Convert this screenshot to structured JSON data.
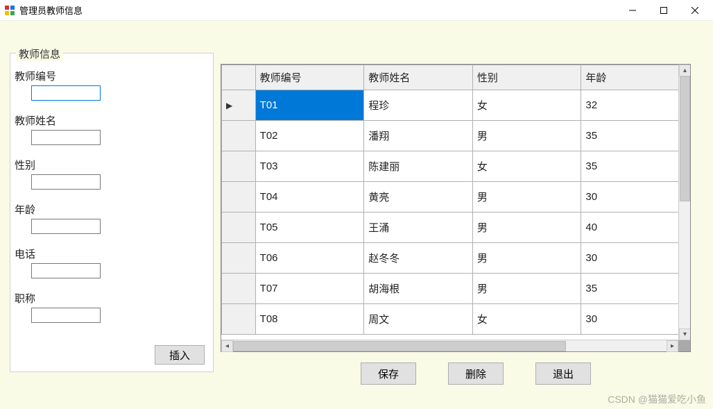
{
  "window": {
    "title": "管理员教师信息"
  },
  "groupbox": {
    "title": "教师信息",
    "fields": {
      "teacher_id": {
        "label": "教师编号",
        "value": ""
      },
      "teacher_name": {
        "label": "教师姓名",
        "value": ""
      },
      "gender": {
        "label": "性别",
        "value": ""
      },
      "age": {
        "label": "年龄",
        "value": ""
      },
      "phone": {
        "label": "电话",
        "value": ""
      },
      "title": {
        "label": "职称",
        "value": ""
      }
    },
    "insert_label": "插入"
  },
  "grid": {
    "columns": [
      "教师编号",
      "教师姓名",
      "性别",
      "年龄"
    ],
    "rows": [
      {
        "id": "T01",
        "name": "程珍",
        "gender": "女",
        "age": "32"
      },
      {
        "id": "T02",
        "name": "潘翔",
        "gender": "男",
        "age": "35"
      },
      {
        "id": "T03",
        "name": "陈建丽",
        "gender": "女",
        "age": "35"
      },
      {
        "id": "T04",
        "name": "黄亮",
        "gender": "男",
        "age": "30"
      },
      {
        "id": "T05",
        "name": "王涌",
        "gender": "男",
        "age": "40"
      },
      {
        "id": "T06",
        "name": "赵冬冬",
        "gender": "男",
        "age": "30"
      },
      {
        "id": "T07",
        "name": "胡海根",
        "gender": "男",
        "age": "35"
      },
      {
        "id": "T08",
        "name": "周文",
        "gender": "女",
        "age": "30"
      }
    ]
  },
  "buttons": {
    "save": "保存",
    "delete": "删除",
    "exit": "退出"
  },
  "watermark": "CSDN @猫猫爱吃小鱼"
}
